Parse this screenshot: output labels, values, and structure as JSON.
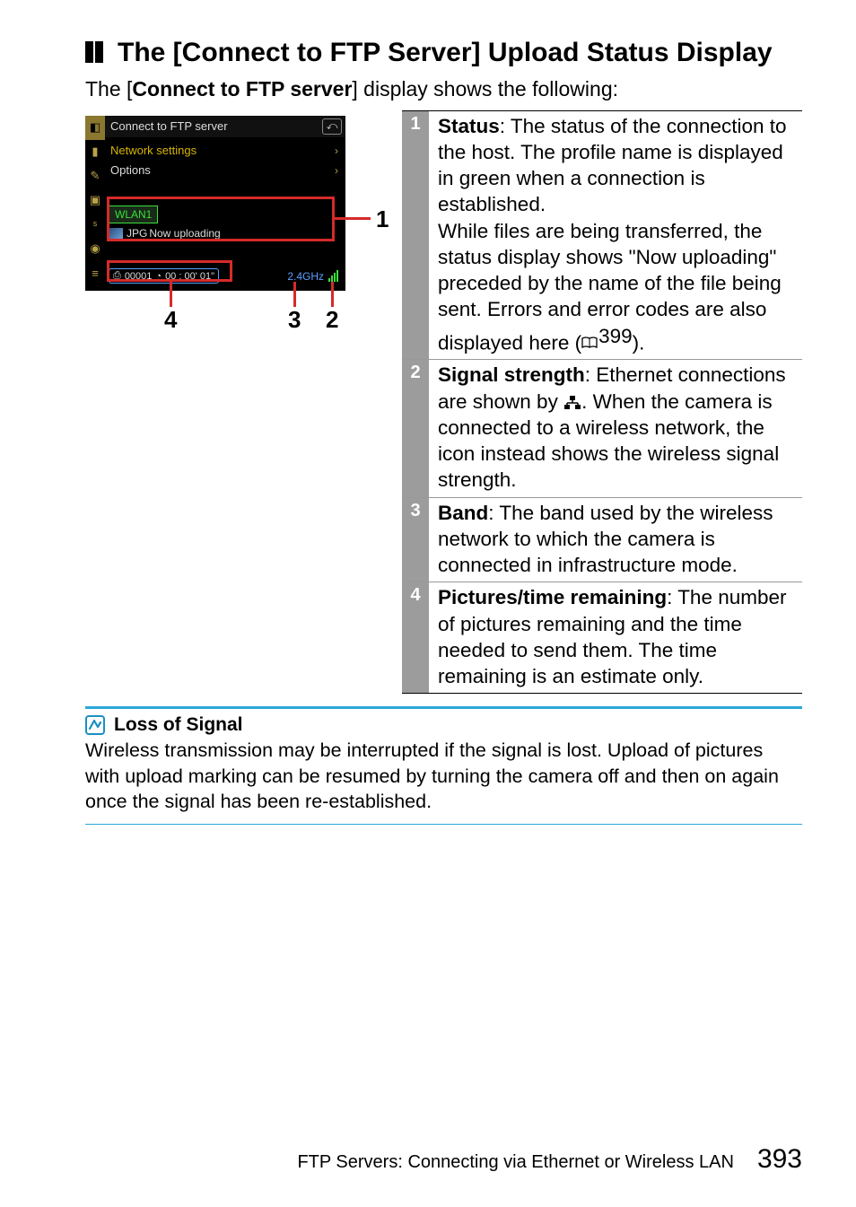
{
  "heading": "The [Connect to FTP Server] Upload Status Display",
  "intro_pre": "The [",
  "intro_bold": "Connect to FTP server",
  "intro_post": "] display shows the following:",
  "camera": {
    "title": "Connect to FTP server",
    "row_network": "Network settings",
    "row_options": "Options",
    "profile_name": "WLAN1",
    "file_type": "JPG",
    "status_text": "Now uploading",
    "pic_icon": "⎙",
    "pic_count": "00001",
    "clock_icon": "◔",
    "time_remaining": "00 : 00' 01\"",
    "band": "2.4GHz"
  },
  "callouts": {
    "c1": "1",
    "c2": "2",
    "c3": "3",
    "c4": "4"
  },
  "defs": [
    {
      "n": "1",
      "term": "Status",
      "body1": ": The status of the connection to the host. The profile name is displayed in green when a connection is established.",
      "body2": "While files are being transferred, the status display shows \"Now uploading\" preceded by the name of the file being sent. Errors and error codes are also displayed here (",
      "ref": "399",
      "body3": ")."
    },
    {
      "n": "2",
      "term": "Signal strength",
      "body1": ": Ethernet connections are shown by ",
      "body2": ". When the camera is connected to a wireless network, the icon instead shows the wireless signal strength."
    },
    {
      "n": "3",
      "term": "Band",
      "body1": ": The band used by the wireless network to which the camera is connected in infrastructure mode."
    },
    {
      "n": "4",
      "term": "Pictures/time remaining",
      "body1": ": The number of pictures remaining and the time needed to send them. The time remaining is an estimate only."
    }
  ],
  "note": {
    "title": "Loss of Signal",
    "body": "Wireless transmission may be interrupted if the signal is lost. Upload of pictures with upload marking can be resumed by turning the camera off and then on again once the signal has been re-established."
  },
  "footer": {
    "section": "FTP Servers: Connecting via Ethernet or Wireless LAN",
    "page": "393"
  }
}
